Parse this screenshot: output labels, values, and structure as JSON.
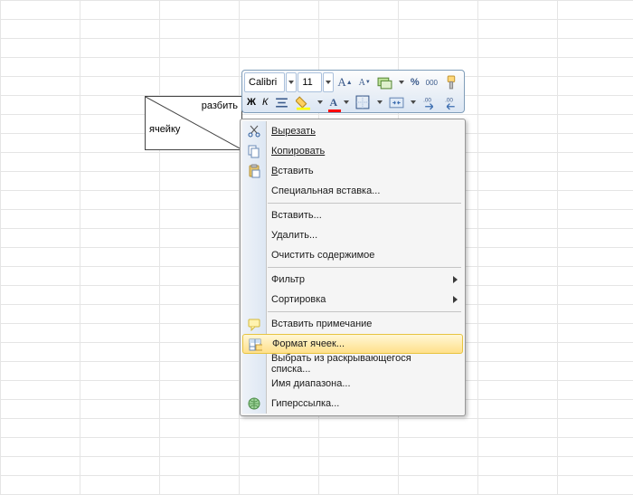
{
  "cell": {
    "top": "разбить",
    "bottom": "ячейку"
  },
  "toolbar": {
    "font": "Calibri",
    "size": "11",
    "bold": "Ж",
    "italic": "К",
    "underline": "А",
    "percent": "%",
    "thousands": "000"
  },
  "menu": {
    "cut": "Вырезать",
    "copy": "Копировать",
    "paste": "Вставить",
    "paste_special": "Специальная вставка...",
    "insert": "Вставить...",
    "delete": "Удалить...",
    "clear": "Очистить содержимое",
    "filter": "Фильтр",
    "sort": "Сортировка",
    "comment": "Вставить примечание",
    "format": "Формат ячеек...",
    "dropdown": "Выбрать из раскрывающегося списка...",
    "range_name": "Имя диапазона...",
    "hyperlink": "Гиперссылка..."
  }
}
